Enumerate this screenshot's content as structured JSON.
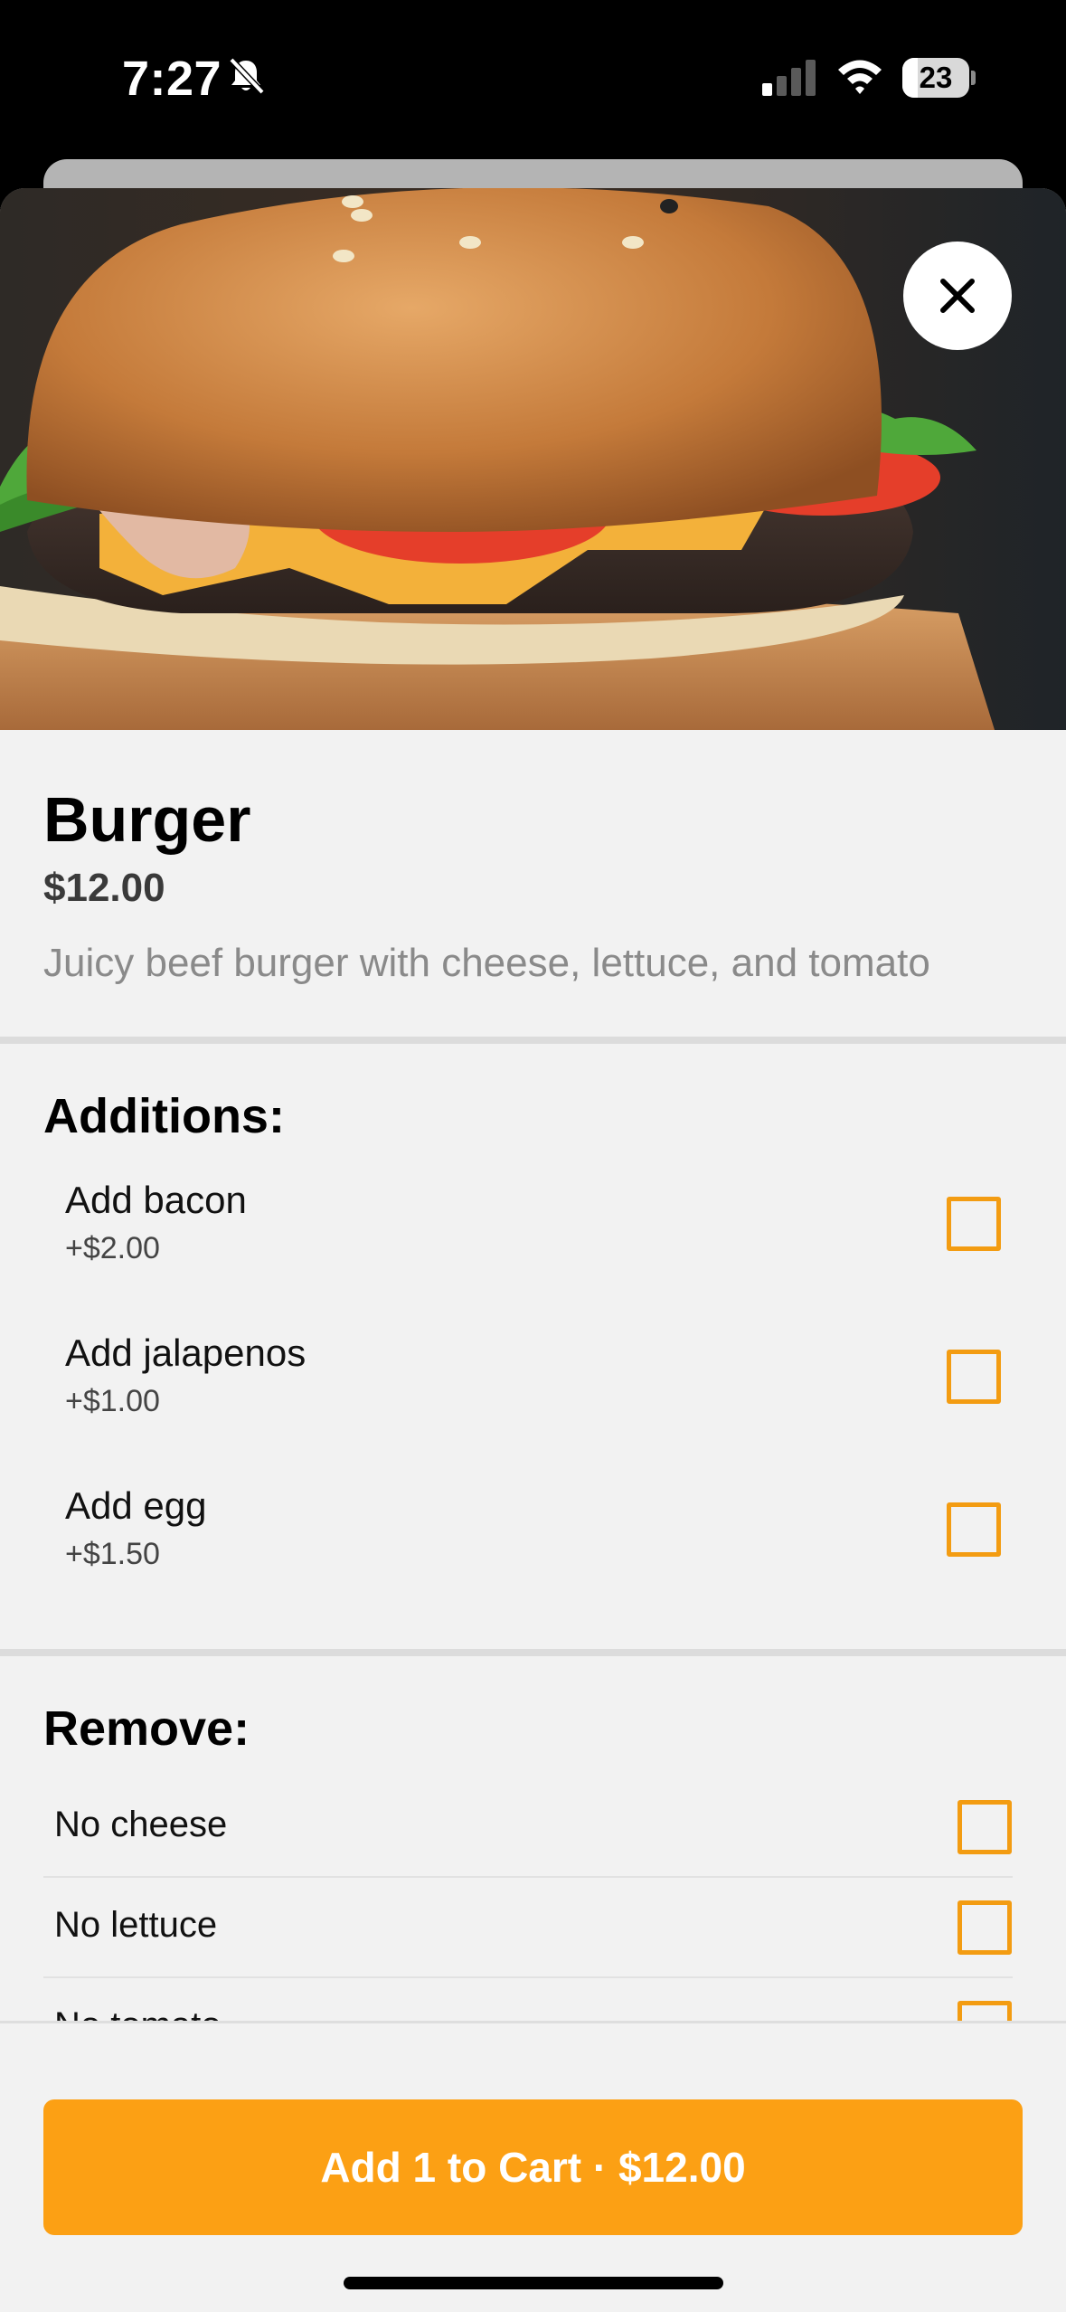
{
  "status_bar": {
    "time": "7:27",
    "battery_percent": "23",
    "battery_level": 0.23,
    "icons": [
      "bell-slash-icon",
      "cellular-signal-icon",
      "wifi-icon",
      "battery-icon"
    ]
  },
  "product": {
    "image": "burger-photo",
    "close_icon": "close-icon",
    "title": "Burger",
    "price": "$12.00",
    "description": "Juicy beef burger with cheese, lettuce, and tomato"
  },
  "additions": {
    "title": "Additions:",
    "items": [
      {
        "label": "Add bacon",
        "price": "+$2.00",
        "checked": false
      },
      {
        "label": "Add jalapenos",
        "price": "+$1.00",
        "checked": false
      },
      {
        "label": "Add egg",
        "price": "+$1.50",
        "checked": false
      }
    ]
  },
  "remove": {
    "title": "Remove:",
    "items": [
      {
        "label": "No cheese",
        "checked": false
      },
      {
        "label": "No lettuce",
        "checked": false
      },
      {
        "label": "No tomato",
        "checked": false
      }
    ]
  },
  "cart": {
    "button_label": "Add 1 to Cart · $12.00"
  },
  "colors": {
    "accent": "#fca014",
    "checkbox_border": "#f39c12",
    "sheet_background": "#f2f2f2",
    "status_bar_background": "#000000"
  }
}
